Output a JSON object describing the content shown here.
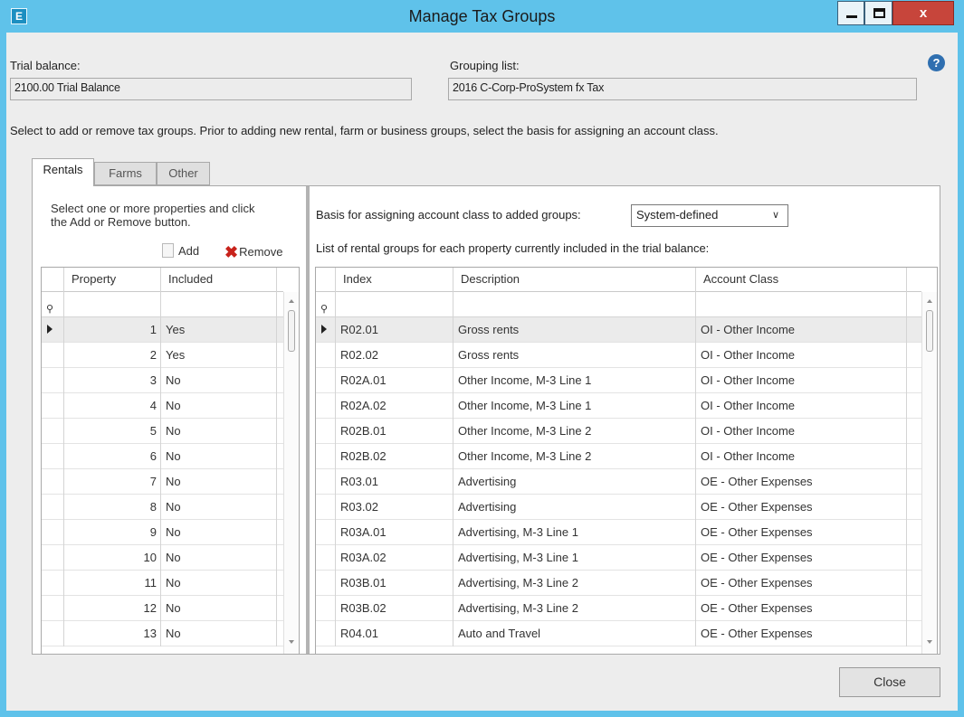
{
  "window": {
    "app_icon": "E",
    "title": "Manage Tax Groups",
    "close_glyph": "x"
  },
  "header": {
    "trial_balance_label": "Trial balance:",
    "trial_balance_value": "2100.00 Trial Balance",
    "grouping_list_label": "Grouping list:",
    "grouping_list_value": "2016 C-Corp-ProSystem fx Tax",
    "help_glyph": "?",
    "instructions": "Select to add or remove tax groups. Prior to adding new rental, farm or business groups, select the basis for assigning an account class."
  },
  "tabs": [
    {
      "label": "Rentals",
      "active": true
    },
    {
      "label": "Farms",
      "active": false
    },
    {
      "label": "Other",
      "active": false
    }
  ],
  "left_panel": {
    "hint": "Select one or more properties and click the Add or Remove button.",
    "add_label": "Add",
    "remove_label": "Remove",
    "columns": [
      "Property",
      "Included"
    ],
    "rows": [
      {
        "property": "1",
        "included": "Yes",
        "selected": true
      },
      {
        "property": "2",
        "included": "Yes",
        "selected": false
      },
      {
        "property": "3",
        "included": "No",
        "selected": false
      },
      {
        "property": "4",
        "included": "No",
        "selected": false
      },
      {
        "property": "5",
        "included": "No",
        "selected": false
      },
      {
        "property": "6",
        "included": "No",
        "selected": false
      },
      {
        "property": "7",
        "included": "No",
        "selected": false
      },
      {
        "property": "8",
        "included": "No",
        "selected": false
      },
      {
        "property": "9",
        "included": "No",
        "selected": false
      },
      {
        "property": "10",
        "included": "No",
        "selected": false
      },
      {
        "property": "11",
        "included": "No",
        "selected": false
      },
      {
        "property": "12",
        "included": "No",
        "selected": false
      },
      {
        "property": "13",
        "included": "No",
        "selected": false
      }
    ]
  },
  "right_panel": {
    "basis_label": "Basis for assigning account class to added groups:",
    "basis_value": "System-defined",
    "list_caption": "List of rental groups for each property currently included in the trial balance:",
    "columns": [
      "Index",
      "Description",
      "Account Class"
    ],
    "rows": [
      {
        "index": "R02.01",
        "description": "Gross rents",
        "account_class": "OI - Other Income",
        "selected": true
      },
      {
        "index": "R02.02",
        "description": "Gross rents",
        "account_class": "OI - Other Income",
        "selected": false
      },
      {
        "index": "R02A.01",
        "description": "Other Income, M-3 Line 1",
        "account_class": "OI - Other Income",
        "selected": false
      },
      {
        "index": "R02A.02",
        "description": "Other Income, M-3 Line 1",
        "account_class": "OI - Other Income",
        "selected": false
      },
      {
        "index": "R02B.01",
        "description": "Other Income, M-3 Line 2",
        "account_class": "OI - Other Income",
        "selected": false
      },
      {
        "index": "R02B.02",
        "description": "Other Income, M-3 Line 2",
        "account_class": "OI - Other Income",
        "selected": false
      },
      {
        "index": "R03.01",
        "description": "Advertising",
        "account_class": "OE - Other Expenses",
        "selected": false
      },
      {
        "index": "R03.02",
        "description": "Advertising",
        "account_class": "OE - Other Expenses",
        "selected": false
      },
      {
        "index": "R03A.01",
        "description": "Advertising, M-3 Line 1",
        "account_class": "OE - Other Expenses",
        "selected": false
      },
      {
        "index": "R03A.02",
        "description": "Advertising, M-3 Line 1",
        "account_class": "OE - Other Expenses",
        "selected": false
      },
      {
        "index": "R03B.01",
        "description": "Advertising, M-3 Line 2",
        "account_class": "OE - Other Expenses",
        "selected": false
      },
      {
        "index": "R03B.02",
        "description": "Advertising, M-3 Line 2",
        "account_class": "OE - Other Expenses",
        "selected": false
      },
      {
        "index": "R04.01",
        "description": "Auto and Travel",
        "account_class": "OE - Other Expenses",
        "selected": false
      }
    ]
  },
  "footer": {
    "close_label": "Close"
  },
  "icons": {
    "filter": "filter-icon",
    "row_indicator": "row-indicator-icon",
    "add": "document-icon",
    "remove": "red-x-icon",
    "help": "help-icon"
  },
  "colors": {
    "titlebar": "#5fc2ea",
    "close_button": "#c7453b",
    "remove_icon": "#c8221b",
    "help_icon": "#2f6fb0",
    "selected_row": "#ebebeb"
  }
}
